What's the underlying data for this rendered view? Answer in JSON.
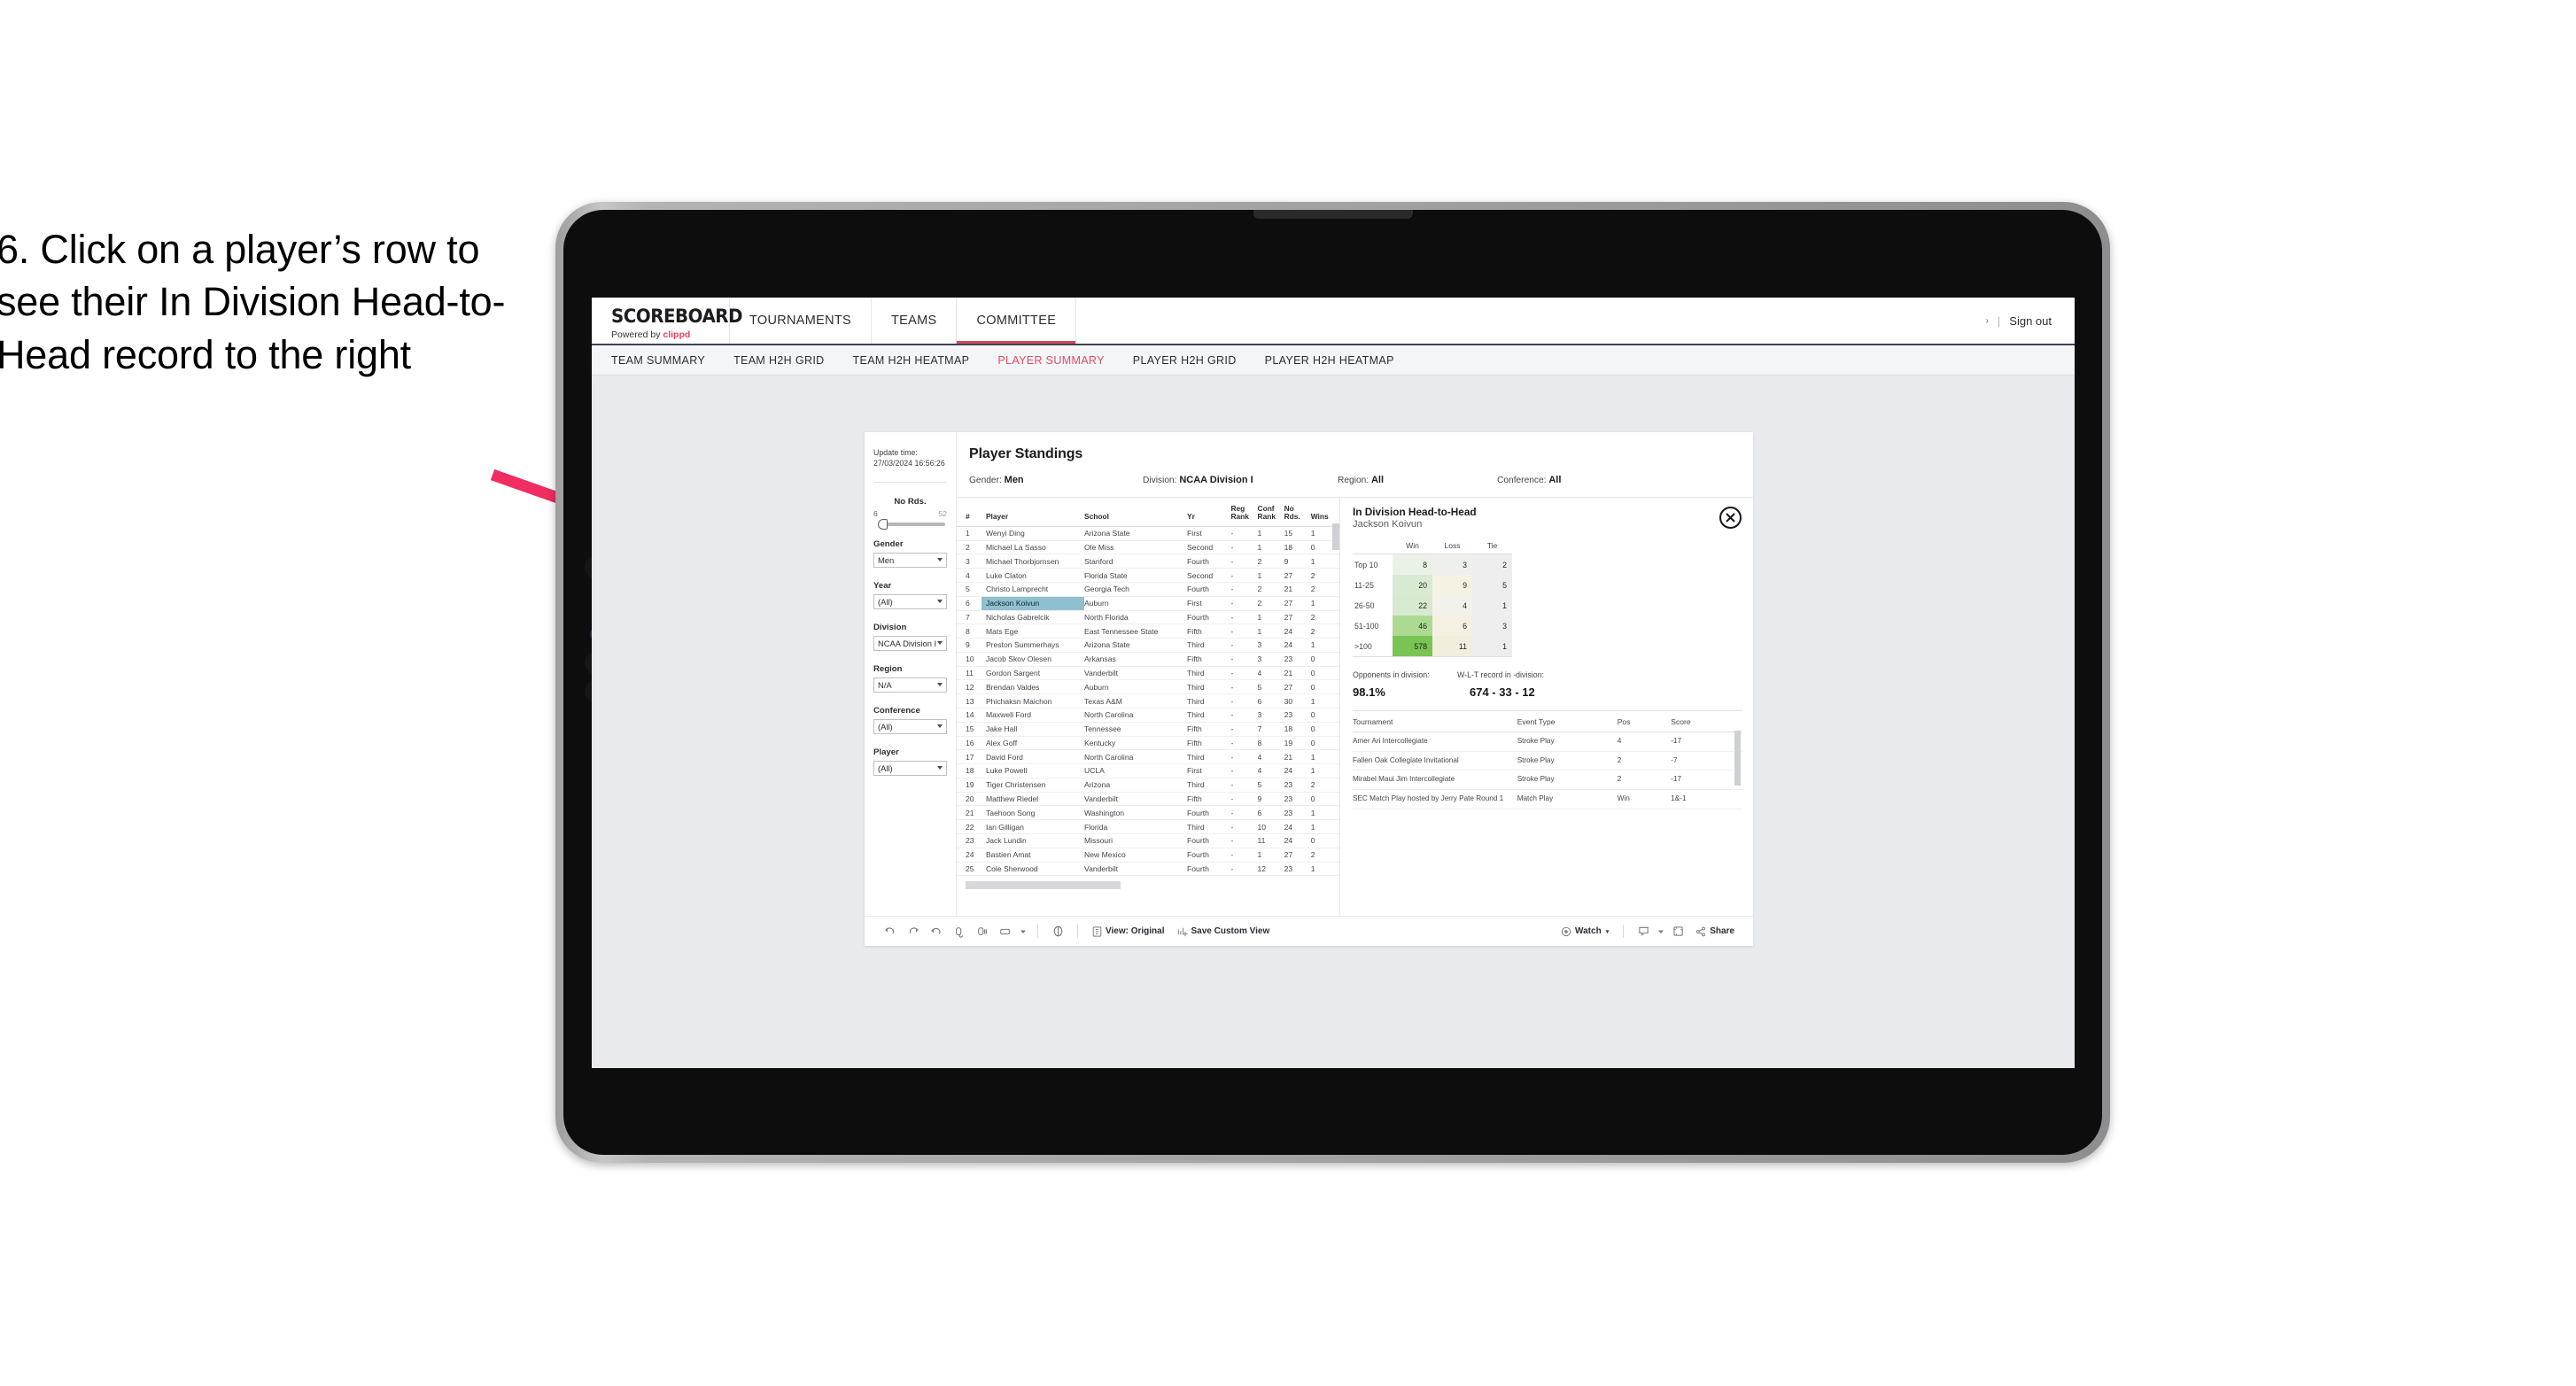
{
  "caption": {
    "text": "6. Click on a player’s row to see their In Division Head-to-Head record to the right"
  },
  "colors": {
    "accent_pink": "#e8405a",
    "active_tab": "#e04a66",
    "selected_row": "#90bfd0",
    "arrow": "#ef2d62",
    "green_high": "#6fc04c",
    "header_rule": "#3d4354"
  },
  "header": {
    "logo_main": "SCOREBOARD",
    "logo_sub_prefix": "Powered by ",
    "logo_sub_brand": "clippd",
    "nav": [
      {
        "label": "TOURNAMENTS",
        "active": false
      },
      {
        "label": "TEAMS",
        "active": false
      },
      {
        "label": "COMMITTEE",
        "active": true
      }
    ],
    "chevron": "›",
    "separator": "|",
    "sign_out": "Sign out"
  },
  "sub_nav": [
    {
      "label": "TEAM SUMMARY",
      "active": false
    },
    {
      "label": "TEAM H2H GRID",
      "active": false
    },
    {
      "label": "TEAM H2H HEATMAP",
      "active": false
    },
    {
      "label": "PLAYER SUMMARY",
      "active": true
    },
    {
      "label": "PLAYER H2H GRID",
      "active": false
    },
    {
      "label": "PLAYER H2H HEATMAP",
      "active": false
    }
  ],
  "filters": {
    "update_time_label": "Update time:",
    "update_time_value": "27/03/2024 16:56:26",
    "slider": {
      "title": "No Rds.",
      "min": "6",
      "max": "52",
      "knob_pct": 4
    },
    "selects": [
      {
        "label": "Gender",
        "value": "Men"
      },
      {
        "label": "Year",
        "value": "(All)"
      },
      {
        "label": "Division",
        "value": "NCAA Division I"
      },
      {
        "label": "Region",
        "value": "N/A"
      },
      {
        "label": "Conference",
        "value": "(All)"
      },
      {
        "label": "Player",
        "value": "(All)"
      }
    ]
  },
  "standings": {
    "title": "Player Standings",
    "meta": [
      {
        "label": "Gender:",
        "value": "Men"
      },
      {
        "label": "Division:",
        "value": "NCAA Division I"
      },
      {
        "label": "Region:",
        "value": "All"
      },
      {
        "label": "Conference:",
        "value": "All"
      }
    ],
    "columns": [
      "#",
      "Player",
      "School",
      "Yr",
      "Reg Rank",
      "Conf Rank",
      "No Rds.",
      "Wins"
    ],
    "columns_wrapped": [
      {
        "l1": "#",
        "l2": ""
      },
      {
        "l1": "Player",
        "l2": ""
      },
      {
        "l1": "School",
        "l2": ""
      },
      {
        "l1": "Yr",
        "l2": ""
      },
      {
        "l1": "Reg",
        "l2": "Rank"
      },
      {
        "l1": "Conf",
        "l2": "Rank"
      },
      {
        "l1": "No",
        "l2": "Rds."
      },
      {
        "l1": "Wins",
        "l2": ""
      }
    ],
    "rows": [
      {
        "rank": "1",
        "player": "Wenyi Ding",
        "school": "Arizona State",
        "yr": "First",
        "reg": "-",
        "conf": "1",
        "no": "15",
        "wins": "1",
        "selected": false
      },
      {
        "rank": "2",
        "player": "Michael La Sasso",
        "school": "Ole Miss",
        "yr": "Second",
        "reg": "-",
        "conf": "1",
        "no": "18",
        "wins": "0",
        "selected": false
      },
      {
        "rank": "3",
        "player": "Michael Thorbjornsen",
        "school": "Stanford",
        "yr": "Fourth",
        "reg": "-",
        "conf": "2",
        "no": "9",
        "wins": "1",
        "selected": false
      },
      {
        "rank": "4",
        "player": "Luke Claton",
        "school": "Florida State",
        "yr": "Second",
        "reg": "-",
        "conf": "1",
        "no": "27",
        "wins": "2",
        "selected": false
      },
      {
        "rank": "5",
        "player": "Christo Lamprecht",
        "school": "Georgia Tech",
        "yr": "Fourth",
        "reg": "-",
        "conf": "2",
        "no": "21",
        "wins": "2",
        "selected": false
      },
      {
        "rank": "6",
        "player": "Jackson Koivun",
        "school": "Auburn",
        "yr": "First",
        "reg": "-",
        "conf": "2",
        "no": "27",
        "wins": "1",
        "selected": true
      },
      {
        "rank": "7",
        "player": "Nicholas Gabrelcik",
        "school": "North Florida",
        "yr": "Fourth",
        "reg": "-",
        "conf": "1",
        "no": "27",
        "wins": "2",
        "selected": false
      },
      {
        "rank": "8",
        "player": "Mats Ege",
        "school": "East Tennessee State",
        "yr": "Fifth",
        "reg": "-",
        "conf": "1",
        "no": "24",
        "wins": "2",
        "selected": false
      },
      {
        "rank": "9",
        "player": "Preston Summerhays",
        "school": "Arizona State",
        "yr": "Third",
        "reg": "-",
        "conf": "3",
        "no": "24",
        "wins": "1",
        "selected": false
      },
      {
        "rank": "10",
        "player": "Jacob Skov Olesen",
        "school": "Arkansas",
        "yr": "Fifth",
        "reg": "-",
        "conf": "3",
        "no": "23",
        "wins": "0",
        "selected": false
      },
      {
        "rank": "11",
        "player": "Gordon Sargent",
        "school": "Vanderbilt",
        "yr": "Third",
        "reg": "-",
        "conf": "4",
        "no": "21",
        "wins": "0",
        "selected": false
      },
      {
        "rank": "12",
        "player": "Brendan Valdes",
        "school": "Auburn",
        "yr": "Third",
        "reg": "-",
        "conf": "5",
        "no": "27",
        "wins": "0",
        "selected": false
      },
      {
        "rank": "13",
        "player": "Phichaksn Maichon",
        "school": "Texas A&M",
        "yr": "Third",
        "reg": "-",
        "conf": "6",
        "no": "30",
        "wins": "1",
        "selected": false
      },
      {
        "rank": "14",
        "player": "Maxwell Ford",
        "school": "North Carolina",
        "yr": "Third",
        "reg": "-",
        "conf": "3",
        "no": "23",
        "wins": "0",
        "selected": false
      },
      {
        "rank": "15",
        "player": "Jake Hall",
        "school": "Tennessee",
        "yr": "Fifth",
        "reg": "-",
        "conf": "7",
        "no": "18",
        "wins": "0",
        "selected": false
      },
      {
        "rank": "16",
        "player": "Alex Goff",
        "school": "Kentucky",
        "yr": "Fifth",
        "reg": "-",
        "conf": "8",
        "no": "19",
        "wins": "0",
        "selected": false
      },
      {
        "rank": "17",
        "player": "David Ford",
        "school": "North Carolina",
        "yr": "Third",
        "reg": "-",
        "conf": "4",
        "no": "21",
        "wins": "1",
        "selected": false
      },
      {
        "rank": "18",
        "player": "Luke Powell",
        "school": "UCLA",
        "yr": "First",
        "reg": "-",
        "conf": "4",
        "no": "24",
        "wins": "1",
        "selected": false
      },
      {
        "rank": "19",
        "player": "Tiger Christensen",
        "school": "Arizona",
        "yr": "Third",
        "reg": "-",
        "conf": "5",
        "no": "23",
        "wins": "2",
        "selected": false
      },
      {
        "rank": "20",
        "player": "Matthew Riedel",
        "school": "Vanderbilt",
        "yr": "Fifth",
        "reg": "-",
        "conf": "9",
        "no": "23",
        "wins": "0",
        "selected": false
      },
      {
        "rank": "21",
        "player": "Taehoon Song",
        "school": "Washington",
        "yr": "Fourth",
        "reg": "-",
        "conf": "6",
        "no": "23",
        "wins": "1",
        "selected": false
      },
      {
        "rank": "22",
        "player": "Ian Gilligan",
        "school": "Florida",
        "yr": "Third",
        "reg": "-",
        "conf": "10",
        "no": "24",
        "wins": "1",
        "selected": false
      },
      {
        "rank": "23",
        "player": "Jack Lundin",
        "school": "Missouri",
        "yr": "Fourth",
        "reg": "-",
        "conf": "11",
        "no": "24",
        "wins": "0",
        "selected": false
      },
      {
        "rank": "24",
        "player": "Bastien Amat",
        "school": "New Mexico",
        "yr": "Fourth",
        "reg": "-",
        "conf": "1",
        "no": "27",
        "wins": "2",
        "selected": false
      },
      {
        "rank": "25",
        "player": "Cole Sherwood",
        "school": "Vanderbilt",
        "yr": "Fourth",
        "reg": "-",
        "conf": "12",
        "no": "23",
        "wins": "1",
        "selected": false
      }
    ]
  },
  "h2h": {
    "title": "In Division Head-to-Head",
    "player": "Jackson Koivun",
    "close_label": "×",
    "chart_data": {
      "type": "heatmap",
      "title": "In Division Head-to-Head",
      "subtitle": "Jackson Koivun",
      "columns": [
        "Win",
        "Loss",
        "Tie"
      ],
      "rows": [
        "Top 10",
        "11-25",
        "26-50",
        "51-100",
        ">100"
      ],
      "values": [
        [
          8,
          3,
          2
        ],
        [
          20,
          9,
          5
        ],
        [
          22,
          4,
          1
        ],
        [
          46,
          6,
          3
        ],
        [
          578,
          11,
          1
        ]
      ],
      "cell_colors": [
        [
          "#eaf2e7",
          "#efefed",
          "#eeeeee"
        ],
        [
          "#d9ead2",
          "#f5f2e4",
          "#eeeeee"
        ],
        [
          "#d7e9cf",
          "#f3f2ea",
          "#eeeeee"
        ],
        [
          "#adda92",
          "#f4f1e3",
          "#eeeeee"
        ],
        [
          "#79c453",
          "#f2eedd",
          "#eeeeee"
        ]
      ]
    },
    "stats": [
      {
        "label": "Opponents in division:",
        "value": "98.1%"
      },
      {
        "label": "W-L-T record in -division:",
        "value": "674 - 33 - 12"
      }
    ],
    "tournament_columns": [
      "Tournament",
      "Event Type",
      "Pos",
      "Score"
    ],
    "tournaments": [
      {
        "name": "Amer Ari Intercollegiate",
        "type": "Stroke Play",
        "pos": "4",
        "score": "-17"
      },
      {
        "name": "Fallen Oak Collegiate Invitational",
        "type": "Stroke Play",
        "pos": "2",
        "score": "-7"
      },
      {
        "name": "Mirabel Maui Jim Intercollegiate",
        "type": "Stroke Play",
        "pos": "2",
        "score": "-17"
      },
      {
        "name": "SEC Match Play hosted by Jerry Pate Round 1",
        "type": "Match Play",
        "pos": "Win",
        "score": "1&-1"
      }
    ]
  },
  "toolbar": {
    "view_label": "View: Original",
    "save_label": "Save Custom View",
    "watch_label": "Watch",
    "share_label": "Share",
    "caret": "▾"
  }
}
